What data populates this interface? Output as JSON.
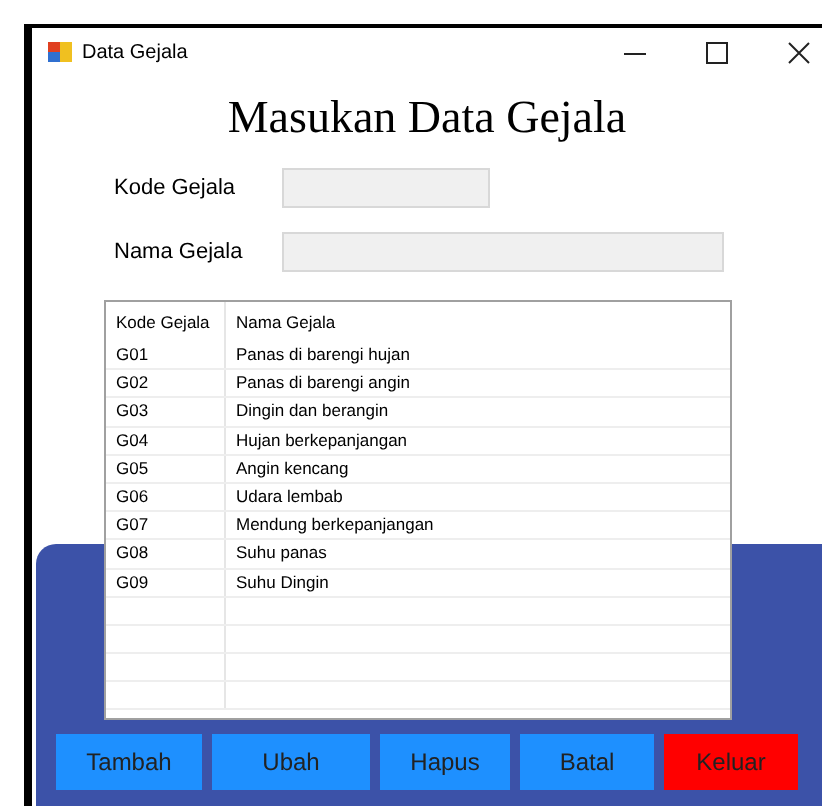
{
  "window": {
    "title": "Data Gejala"
  },
  "heading": "Masukan Data Gejala",
  "fields": [
    {
      "label": "Kode Gejala"
    },
    {
      "label": "Nama Gejala"
    }
  ],
  "table": {
    "columns": [
      "Kode Gejala",
      "Nama Gejala"
    ],
    "rows": [
      [
        "G01",
        "Panas di barengi hujan"
      ],
      [
        "G02",
        "Panas di barengi angin"
      ],
      [
        "G03",
        "Dingin dan berangin"
      ],
      [
        "G04",
        "Hujan berkepanjangan"
      ],
      [
        "G05",
        "Angin kencang"
      ],
      [
        "G06",
        "Udara lembab"
      ],
      [
        "G07",
        "Mendung berkepanjangan"
      ],
      [
        "G08",
        "Suhu panas"
      ],
      [
        "G09",
        "Suhu Dingin"
      ]
    ]
  },
  "buttons": [
    {
      "label": "Tambah",
      "color": "#1e90ff"
    },
    {
      "label": "Ubah",
      "color": "#1e90ff"
    },
    {
      "label": "Hapus",
      "color": "#1e90ff"
    },
    {
      "label": "Batal",
      "color": "#1e90ff"
    },
    {
      "label": "Keluar",
      "color": "#ff0000"
    }
  ]
}
